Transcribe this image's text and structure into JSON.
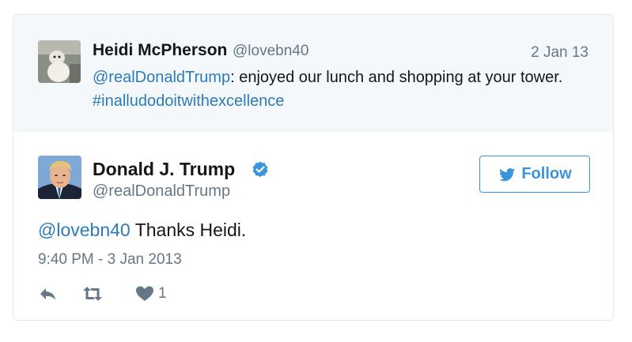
{
  "parent_tweet": {
    "author_name": "Heidi McPherson",
    "author_handle": "@lovebn40",
    "date": "2 Jan 13",
    "mention": "@realDonaldTrump",
    "text": ": enjoyed our lunch and shopping at your tower. ",
    "hashtag": "#inalludodoitwithexcellence"
  },
  "tweet": {
    "author_name": "Donald J. Trump",
    "author_handle": "@realDonaldTrump",
    "follow_label": "Follow",
    "mention": "@lovebn40",
    "text": " Thanks Heidi.",
    "timestamp": "9:40 PM - 3 Jan 2013",
    "like_count": "1"
  },
  "icons": {
    "verified": "verified-badge-icon",
    "follow": "twitter-bird-icon",
    "reply": "reply-icon",
    "retweet": "retweet-icon",
    "like": "heart-icon"
  },
  "colors": {
    "link": "#2b7bb9",
    "follow": "#3b94d9",
    "muted": "#657786",
    "parent_bg": "#f5f8fa"
  }
}
